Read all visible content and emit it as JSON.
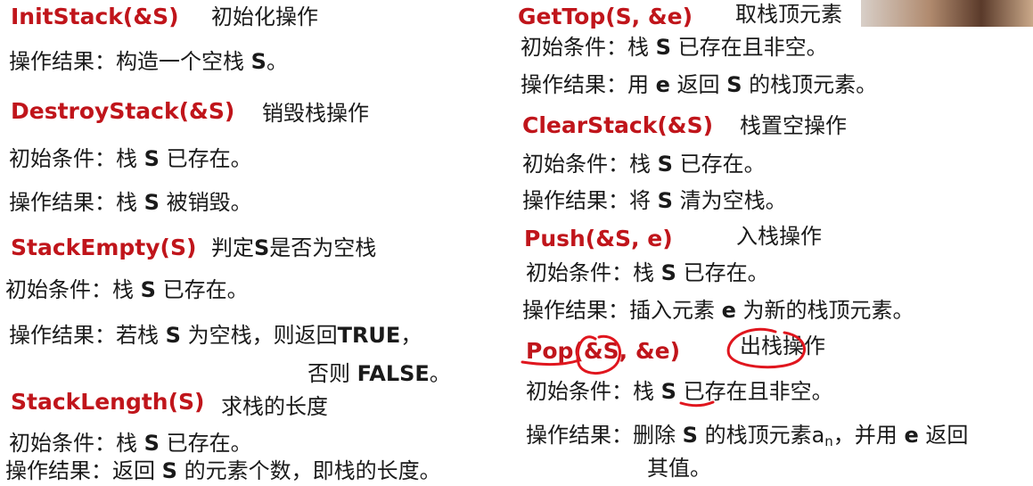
{
  "left": {
    "initstack": {
      "fn": "InitStack(&S)",
      "desc": "初始化操作",
      "result_label": "操作结果：",
      "result_pre": "构造一个空栈 ",
      "result_var": "S",
      "result_post": "。"
    },
    "destroystack": {
      "fn": "DestroyStack(&S)",
      "desc": "销毁栈操作",
      "init_label": "初始条件：",
      "init_pre": "栈 ",
      "init_var": "S",
      "init_post": " 已存在。",
      "result_label": "操作结果：",
      "result_pre": "栈 ",
      "result_var": "S",
      "result_post": " 被销毁。"
    },
    "stackempty": {
      "fn": "StackEmpty(S)",
      "desc_pre": "判定",
      "desc_var": "S",
      "desc_post": "是否为空栈",
      "init_label": "初始条件：",
      "init_pre": "栈 ",
      "init_var": "S",
      "init_post": " 已存在。",
      "result_label": "操作结果：",
      "result_pre": "若栈 ",
      "result_var": "S",
      "result_mid": " 为空栈，则返回",
      "result_true": "TRUE",
      "result_comma": "，",
      "else_pre": "否则 ",
      "else_false": "FALSE",
      "else_post": "。"
    },
    "stacklength": {
      "fn": "StackLength(S)",
      "desc": "求栈的长度",
      "init_label": "初始条件：",
      "init_pre": "栈 ",
      "init_var": "S",
      "init_post": " 已存在。",
      "result_label": "操作结果：",
      "result_pre": "返回 ",
      "result_var": "S",
      "result_post": " 的元素个数，即栈的长度。"
    }
  },
  "right": {
    "gettop": {
      "fn": "GetTop(S, &e)",
      "desc": "取栈顶元素",
      "init_label": "初始条件：",
      "init_pre": "栈 ",
      "init_var": "S",
      "init_post": " 已存在且非空。",
      "result_label": "操作结果：",
      "result_pre": "用 ",
      "result_var_e": "e",
      "result_mid": " 返回 ",
      "result_var_s": "S",
      "result_post": " 的栈顶元素。"
    },
    "clearstack": {
      "fn": "ClearStack(&S)",
      "desc": "栈置空操作",
      "init_label": "初始条件：",
      "init_pre": "栈 ",
      "init_var": "S",
      "init_post": " 已存在。",
      "result_label": "操作结果：",
      "result_pre": "将 ",
      "result_var": "S",
      "result_post": " 清为空栈。"
    },
    "push": {
      "fn": "Push(&S, e)",
      "desc": "入栈操作",
      "init_label": "初始条件：",
      "init_pre": "栈 ",
      "init_var": "S",
      "init_post": " 已存在。",
      "result_label": "操作结果：",
      "result_pre": "插入元素 ",
      "result_var": "e",
      "result_post": " 为新的栈顶元素。"
    },
    "pop": {
      "fn": "Pop(&S, &e)",
      "desc": "出栈操作",
      "init_label": "初始条件：",
      "init_pre": "栈 ",
      "init_var": "S",
      "init_post": " 已存在且非空。",
      "result_label": "操作结果：",
      "result_pre": "删除 ",
      "result_var_s": "S",
      "result_mid": " 的栈顶元素a",
      "result_sub": "n",
      "result_mid2": "，并用 ",
      "result_var_e": "e",
      "result_post": " 返回",
      "result_line2": "其值。"
    }
  },
  "colors": {
    "function_name": "#c0151b",
    "annotation": "#e0161e"
  }
}
